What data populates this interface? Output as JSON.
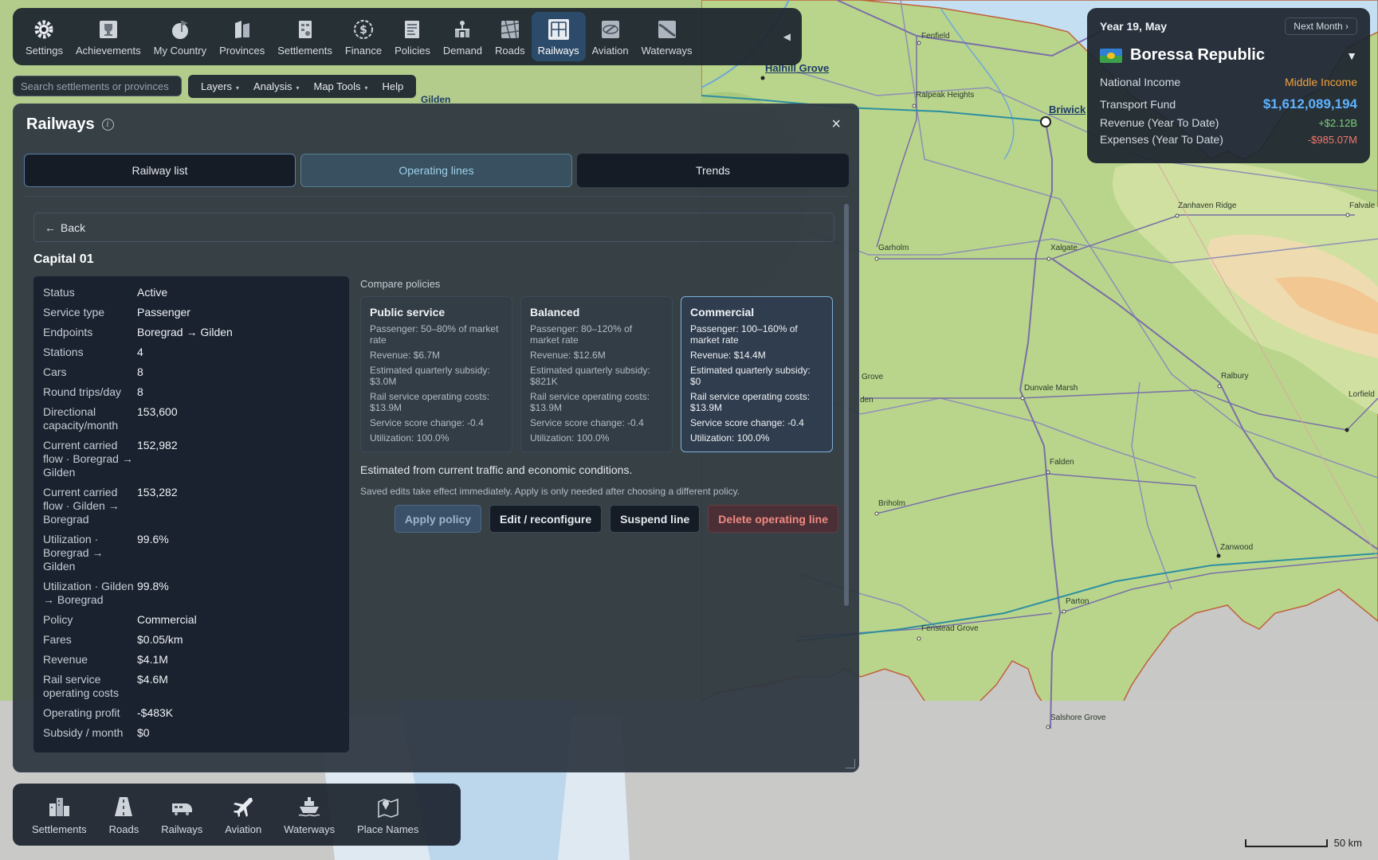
{
  "toolbar": {
    "items": [
      {
        "label": "Settings",
        "icon": "gear-icon"
      },
      {
        "label": "Achievements",
        "icon": "trophy-icon"
      },
      {
        "label": "My Country",
        "icon": "flag-icon"
      },
      {
        "label": "Provinces",
        "icon": "provinces-icon"
      },
      {
        "label": "Settlements",
        "icon": "settlements-icon"
      },
      {
        "label": "Finance",
        "icon": "dollar-coin-icon"
      },
      {
        "label": "Policies",
        "icon": "policies-document-icon"
      },
      {
        "label": "Demand",
        "icon": "demand-icon"
      },
      {
        "label": "Roads",
        "icon": "roads-map-icon"
      },
      {
        "label": "Railways",
        "icon": "railways-icon",
        "active": true
      },
      {
        "label": "Aviation",
        "icon": "aviation-icon"
      },
      {
        "label": "Waterways",
        "icon": "waterways-icon"
      }
    ],
    "collapse": "◀"
  },
  "search": {
    "placeholder": "Search settlements or provinces"
  },
  "menubar": {
    "layers": "Layers",
    "analysis": "Analysis",
    "map_tools": "Map Tools",
    "help": "Help",
    "caret": "▾"
  },
  "status": {
    "date": "Year 19, May",
    "next_month": "Next Month ›",
    "country": "Boressa Republic",
    "dropdown": "▼",
    "rows": [
      {
        "label": "National Income",
        "value": "Middle Income"
      },
      {
        "label": "Transport Fund",
        "value": "$1,612,089,194"
      },
      {
        "label": "Revenue (Year To Date)",
        "value": "+$2.12B"
      },
      {
        "label": "Expenses (Year To Date)",
        "value": "-$985.07M"
      }
    ],
    "colors": {
      "income": "#f0a23c",
      "fund": "#5fb3ff",
      "revenue": "#7ed07a",
      "expenses": "#f07a6e"
    }
  },
  "panel": {
    "title": "Railways",
    "info": "i",
    "close": "×",
    "tabs": [
      "Railway list",
      "Operating lines",
      "Trends"
    ],
    "back": "Back",
    "back_arrow": "←",
    "line_name": "Capital 01",
    "details": [
      {
        "key": "Status",
        "value": "Active"
      },
      {
        "key": "Service type",
        "value": "Passenger"
      },
      {
        "key": "Endpoints",
        "value": "Boregrad → Gilden"
      },
      {
        "key": "Stations",
        "value": "4"
      },
      {
        "key": "Cars",
        "value": "8"
      },
      {
        "key": "Round trips/day",
        "value": "8"
      },
      {
        "key": "Directional capacity/month",
        "value": "153,600"
      },
      {
        "key": "Current carried flow · Boregrad → Gilden",
        "value": "152,982"
      },
      {
        "key": "Current carried flow · Gilden → Boregrad",
        "value": "153,282"
      },
      {
        "key": "Utilization · Boregrad → Gilden",
        "value": "99.6%"
      },
      {
        "key": "Utilization · Gilden → Boregrad",
        "value": "99.8%"
      },
      {
        "key": "Policy",
        "value": "Commercial"
      },
      {
        "key": "Fares",
        "value": "$0.05/km"
      },
      {
        "key": "Revenue",
        "value": "$4.1M"
      },
      {
        "key": "Rail service operating costs",
        "value": "$4.6M"
      },
      {
        "key": "Operating profit",
        "value": "-$483K"
      },
      {
        "key": "Subsidy / month",
        "value": "$0"
      }
    ],
    "compare_title": "Compare policies",
    "policies": [
      {
        "title": "Public service",
        "lines": [
          "Passenger: 50–80% of market rate",
          "Revenue: $6.7M",
          "Estimated quarterly subsidy: $3.0M",
          "Rail service operating costs: $13.9M",
          "Service score change: -0.4",
          "Utilization: 100.0%"
        ]
      },
      {
        "title": "Balanced",
        "lines": [
          "Passenger: 80–120% of market rate",
          "Revenue: $12.6M",
          "Estimated quarterly subsidy: $821K",
          "Rail service operating costs: $13.9M",
          "Service score change: -0.4",
          "Utilization: 100.0%"
        ]
      },
      {
        "title": "Commercial",
        "selected": true,
        "lines": [
          "Passenger: 100–160% of market rate",
          "Revenue: $14.4M",
          "Estimated quarterly subsidy: $0",
          "Rail service operating costs: $13.9M",
          "Service score change: -0.4",
          "Utilization: 100.0%"
        ]
      }
    ],
    "estimate_note": "Estimated from current traffic and economic conditions.",
    "saved_note": "Saved edits take effect immediately. Apply is only needed after choosing a different policy.",
    "actions": {
      "apply": "Apply policy",
      "edit": "Edit / reconfigure",
      "suspend": "Suspend line",
      "delete": "Delete operating line"
    }
  },
  "bottombar": {
    "items": [
      {
        "label": "Settlements",
        "icon": "buildings-icon"
      },
      {
        "label": "Roads",
        "icon": "road-icon"
      },
      {
        "label": "Railways",
        "icon": "train-icon"
      },
      {
        "label": "Aviation",
        "icon": "airplane-icon"
      },
      {
        "label": "Waterways",
        "icon": "ship-icon"
      },
      {
        "label": "Place Names",
        "icon": "map-pin-icon"
      }
    ]
  },
  "map": {
    "towns": [
      "Fenfield",
      "Halhill Grove",
      "Gilden",
      "Ralpeak Heights",
      "Briwick",
      "Zanhaven Ridge",
      "Falvale",
      "Garholm",
      "Xalgate",
      "Dunvale Marsh",
      "Ralbury",
      "Lorfield",
      "Falden",
      "Briholm",
      "Zanwood",
      "Parton",
      "Fenstead Grove",
      "Salshore Grove",
      "Grove",
      "den"
    ],
    "scale": "50 km"
  }
}
